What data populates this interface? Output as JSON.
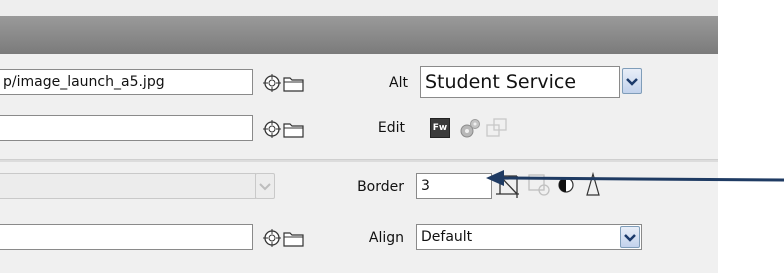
{
  "src_field": {
    "value": "p/image_launch_a5.jpg"
  },
  "link_field": {
    "value": ""
  },
  "class_field": {
    "value": ""
  },
  "target_field": {
    "value": ""
  },
  "alt": {
    "label": "Alt",
    "value": "Student Service"
  },
  "edit": {
    "label": "Edit",
    "fw_label": "Fw"
  },
  "border": {
    "label": "Border",
    "value": "3"
  },
  "align": {
    "label": "Align",
    "value": "Default"
  },
  "icons": [
    "point-to-file-icon",
    "browse-folder-icon",
    "fireworks-edit-icon",
    "optimize-icon",
    "update-from-original-icon",
    "crop-icon",
    "resample-icon",
    "brightness-contrast-icon",
    "sharpen-icon"
  ],
  "colors": {
    "titlebar": "#8a8a8a",
    "panel": "#f0f0f0",
    "arrow": "#1f3b63"
  }
}
